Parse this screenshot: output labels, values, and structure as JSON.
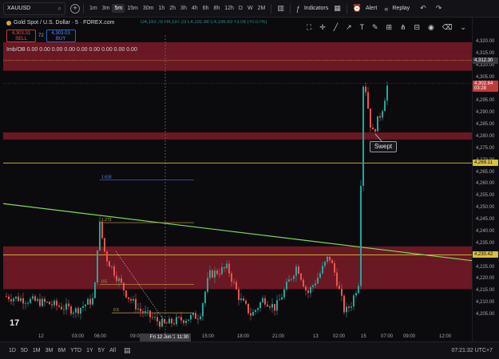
{
  "toolbar": {
    "symbol": "XAUUSD",
    "timeframes": [
      "1m",
      "3m",
      "5m",
      "15m",
      "30m",
      "1h",
      "2h",
      "3h",
      "4h",
      "6h",
      "8h",
      "12h",
      "D",
      "W",
      "2M"
    ],
    "active_timeframe": "5m",
    "indicators_label": "Indicators",
    "alert_label": "Alert",
    "replay_label": "Replay"
  },
  "legend": {
    "title": "Gold Spot / U.S. Dollar · 5 · FOREX.com",
    "ohlc": "O4,192.78 H4,197.23 L4,191.98 C4,196.83 +3.08 (+0.07%)"
  },
  "trade": {
    "sell_price": "4,303.31",
    "sell_label": "SELL",
    "spread": "72",
    "buy_price": "4,303.03",
    "buy_label": "BUY"
  },
  "indicator_row": "Imb/OB 0.00 0.00 0.00 0.00 0.00 0.00 0.00 0.00 0.00",
  "chart_data": {
    "type": "candlestick",
    "y_ticks": [
      4205,
      4210,
      4215,
      4220,
      4225,
      4230,
      4235,
      4240,
      4245,
      4250,
      4255,
      4260,
      4265,
      4270,
      4275,
      4280,
      4285,
      4290,
      4295,
      4300,
      4305,
      4310,
      4315,
      4320
    ],
    "y_tick_labels": [
      "4,205.00",
      "4,210.00",
      "4,215.00",
      "4,220.00",
      "4,225.00",
      "4,230.00",
      "4,235.00",
      "4,240.00",
      "4,245.00",
      "4,250.00",
      "4,255.00",
      "4,260.00",
      "4,265.00",
      "4,270.00",
      "4,275.00",
      "4,280.00",
      "4,285.00",
      "4,290.00",
      "4,295.00",
      "4,300.00",
      "4,305.00",
      "4,310.00",
      "4,315.00",
      "4,320.00"
    ],
    "ylim": [
      4200,
      4323
    ],
    "x_tick_labels": [
      "12",
      "03:00",
      "06:00",
      "09:00",
      "15:00",
      "18:00",
      "21:00",
      "13",
      "02:00",
      "15",
      "07:00",
      "09:00",
      "12:00"
    ],
    "cursor_date": "Fri 12 Jun '26",
    "cursor_time": "11:30",
    "price_tags": [
      {
        "value": 4312.3,
        "label": "4,312.30",
        "color": "#3b3b42"
      },
      {
        "value": 4302.64,
        "label": "4,302.64",
        "sub": "03:28",
        "color": "#c23b3b"
      },
      {
        "value": 4269.11,
        "label": "4,269.11",
        "color": "#d9c13b"
      },
      {
        "value": 4230.42,
        "label": "4,230.42",
        "color": "#d9c13b"
      }
    ],
    "zones": [
      {
        "from": 4316,
        "to": 4320
      },
      {
        "from": 4308,
        "to": 4316
      },
      {
        "from": 4279,
        "to": 4282
      },
      {
        "from": 4227,
        "to": 4234
      },
      {
        "from": 4216,
        "to": 4227
      }
    ],
    "fib_levels": [
      {
        "label": "1.618",
        "value": 4262
      },
      {
        "label": "1.272",
        "value": 4244
      },
      {
        "label": "0.5",
        "value": 4218
      },
      {
        "label": "0.5",
        "value": 4206
      }
    ],
    "annotation": "Swept",
    "watermark": "17"
  },
  "ranges": [
    "1D",
    "5D",
    "1M",
    "3M",
    "6M",
    "YTD",
    "1Y",
    "5Y",
    "All"
  ],
  "clock": "07:21:32 UTC+7",
  "colors": {
    "up": "#26a69a",
    "down": "#ef5350",
    "zone": "#8b1e2b",
    "trend": "#7ed957",
    "level": "#d9c13b"
  }
}
